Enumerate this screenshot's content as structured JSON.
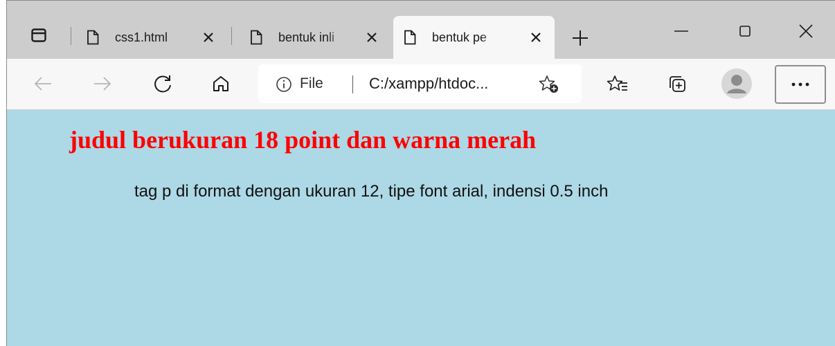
{
  "tabs": [
    {
      "title": "css1.html"
    },
    {
      "title": "bentuk inli"
    },
    {
      "title": "bentuk pe"
    }
  ],
  "address_bar": {
    "scheme": "File",
    "url": "C:/xampp/htdoc..."
  },
  "page": {
    "heading": "judul berukuran 18 point dan warna merah",
    "paragraph": "tag p di format dengan ukuran 12, tipe font arial, indensi 0.5 inch"
  },
  "colors": {
    "page_background": "#add8e6",
    "heading": "#ff0000",
    "tabstrip": "#cdcdcd",
    "toolbar": "#f7f7f7"
  },
  "icons": {
    "tab_actions": "tab-actions-icon",
    "tab_favicon": "page-icon",
    "tab_close": "close-icon",
    "new_tab": "plus-icon",
    "minimize": "minimize-icon",
    "maximize": "maximize-icon",
    "window_close": "close-icon",
    "back": "arrow-left-icon",
    "forward": "arrow-right-icon",
    "refresh": "refresh-icon",
    "home": "home-icon",
    "site_info": "info-icon",
    "add_favorite": "star-plus-icon",
    "favorites": "favorites-list-icon",
    "collections": "collections-icon",
    "profile": "avatar",
    "more": "ellipsis-icon"
  }
}
